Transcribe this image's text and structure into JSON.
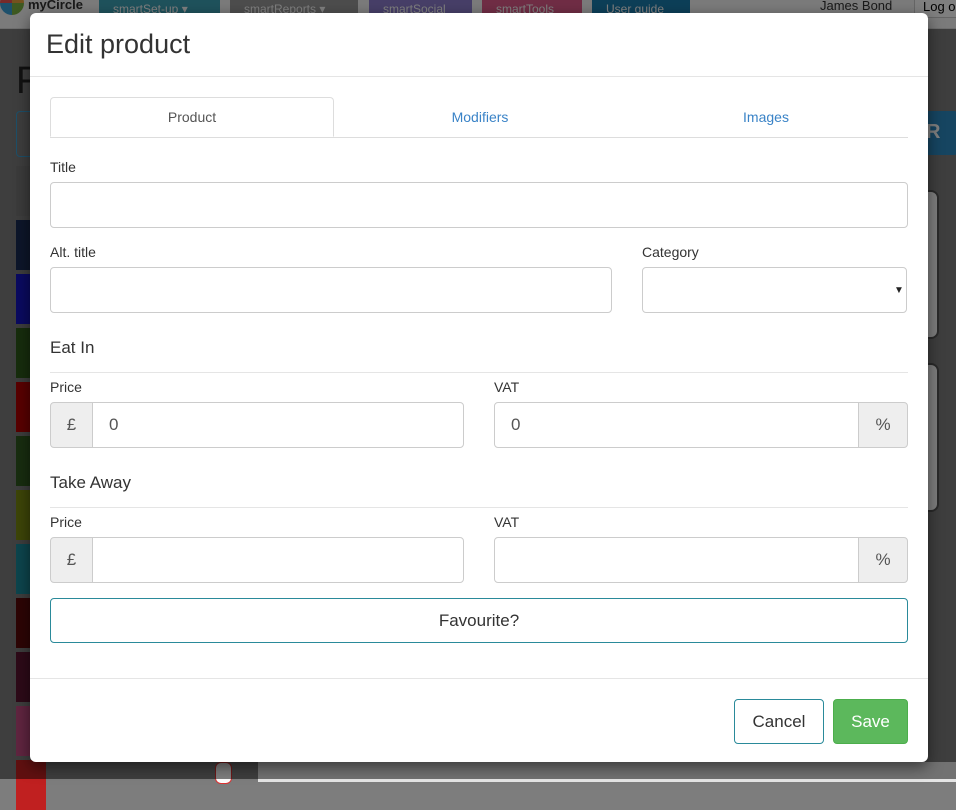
{
  "background": {
    "brand": "myCircle",
    "nav": [
      {
        "label": "smartSet-up ▾",
        "color": "#3fa4b8"
      },
      {
        "label": "smartReports ▾",
        "color": "#9a9a9a"
      },
      {
        "label": "smartSocial",
        "color": "#8f7fd0"
      },
      {
        "label": "smartTools",
        "color": "#e05a8a"
      },
      {
        "label": "User guide",
        "color": "#1a7fb0"
      }
    ],
    "user": "James Bond",
    "logout": "Log o",
    "heading": "F",
    "swatches": [
      "#777777",
      "#1b2d55",
      "#1414c0",
      "#2e5a1a",
      "#b30000",
      "#305a20",
      "#7a8a10",
      "#1a8a9a",
      "#5a0a0a",
      "#5a1530",
      "#c04a80",
      "#c02020"
    ]
  },
  "modal": {
    "title": "Edit product",
    "tabs": [
      "Product",
      "Modifiers",
      "Images"
    ],
    "active_tab": "Product",
    "fields": {
      "title_label": "Title",
      "title_value": "",
      "alt_title_label": "Alt. title",
      "alt_title_value": "",
      "category_label": "Category",
      "category_value": ""
    },
    "eat_in": {
      "heading": "Eat In",
      "price_label": "Price",
      "currency": "£",
      "price_value": "0",
      "vat_label": "VAT",
      "vat_value": "0",
      "percent": "%"
    },
    "take_away": {
      "heading": "Take Away",
      "price_label": "Price",
      "currency": "£",
      "price_value": "",
      "vat_label": "VAT",
      "vat_value": "",
      "percent": "%"
    },
    "favourite_label": "Favourite?",
    "cancel_label": "Cancel",
    "save_label": "Save",
    "colors": {
      "save": "#5cb85c",
      "link": "#3a83c7",
      "accent_border": "#2a8a9a"
    }
  }
}
